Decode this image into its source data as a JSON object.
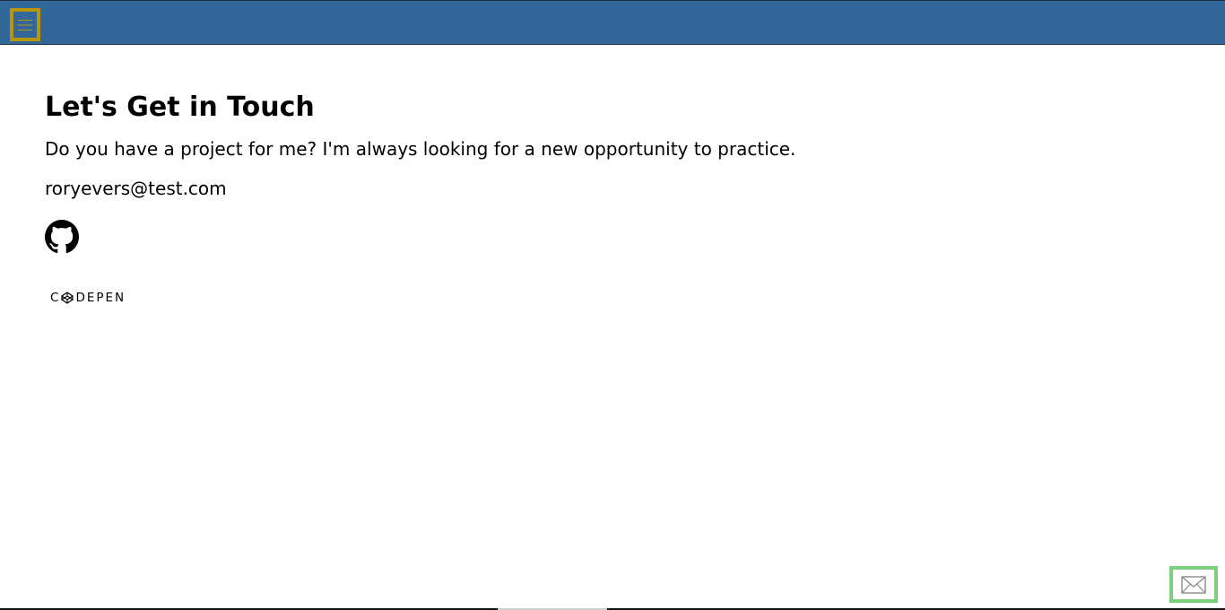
{
  "header": {
    "menu_icon": "hamburger-icon",
    "background_color": "#336699",
    "menu_border_color": "#b8960c"
  },
  "contact": {
    "title": "Let's Get in Touch",
    "intro": "Do you have a project for me? I'm always looking for a new opportunity to practice.",
    "email": "roryevers@test.com",
    "links": {
      "github_icon": "github-icon",
      "codepen_label_prefix": "C",
      "codepen_label_suffix": "DEPEN",
      "codepen_icon": "codepen-icon"
    }
  },
  "floating": {
    "mail_icon": "envelope-icon",
    "border_color": "#7ccf7c"
  }
}
